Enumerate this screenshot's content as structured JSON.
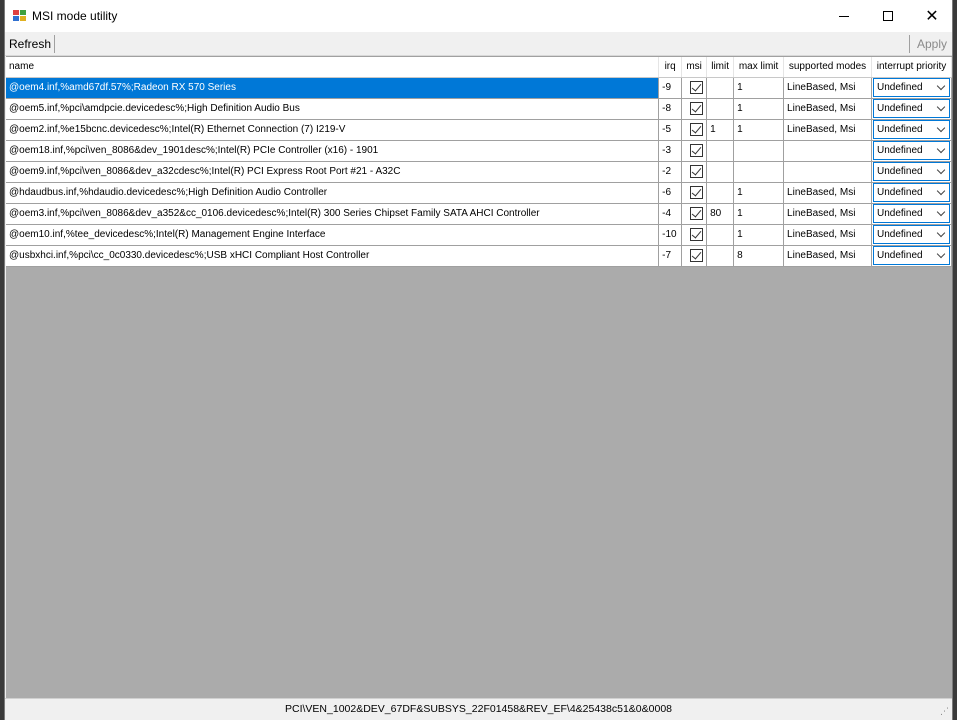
{
  "window": {
    "title": "MSI mode utility"
  },
  "toolbar": {
    "refresh_label": "Refresh",
    "apply_label": "Apply"
  },
  "columns": [
    "name",
    "irq",
    "msi",
    "limit",
    "max limit",
    "supported modes",
    "interrupt priority"
  ],
  "rows": [
    {
      "name": "@oem4.inf,%amd67df.57%;Radeon RX 570 Series",
      "irq": "-9",
      "msi": true,
      "limit": "",
      "max_limit": "1",
      "modes": "LineBased, Msi",
      "priority": "Undefined"
    },
    {
      "name": "@oem5.inf,%pci\\amdpcie.devicedesc%;High Definition Audio Bus",
      "irq": "-8",
      "msi": true,
      "limit": "",
      "max_limit": "1",
      "modes": "LineBased, Msi",
      "priority": "Undefined"
    },
    {
      "name": "@oem2.inf,%e15bcnc.devicedesc%;Intel(R) Ethernet Connection (7) I219-V",
      "irq": "-5",
      "msi": true,
      "limit": "1",
      "max_limit": "1",
      "modes": "LineBased, Msi",
      "priority": "Undefined"
    },
    {
      "name": "@oem18.inf,%pci\\ven_8086&dev_1901desc%;Intel(R) PCIe Controller (x16) - 1901",
      "irq": "-3",
      "msi": true,
      "limit": "",
      "max_limit": "",
      "modes": "",
      "priority": "Undefined"
    },
    {
      "name": "@oem9.inf,%pci\\ven_8086&dev_a32cdesc%;Intel(R) PCI Express Root Port #21 - A32C",
      "irq": "-2",
      "msi": true,
      "limit": "",
      "max_limit": "",
      "modes": "",
      "priority": "Undefined"
    },
    {
      "name": "@hdaudbus.inf,%hdaudio.devicedesc%;High Definition Audio Controller",
      "irq": "-6",
      "msi": true,
      "limit": "",
      "max_limit": "1",
      "modes": "LineBased, Msi",
      "priority": "Undefined"
    },
    {
      "name": "@oem3.inf,%pci\\ven_8086&dev_a352&cc_0106.devicedesc%;Intel(R) 300 Series Chipset Family SATA AHCI Controller",
      "irq": "-4",
      "msi": true,
      "limit": "80",
      "max_limit": "1",
      "modes": "LineBased, Msi",
      "priority": "Undefined"
    },
    {
      "name": "@oem10.inf,%tee_devicedesc%;Intel(R) Management Engine Interface",
      "irq": "-10",
      "msi": true,
      "limit": "",
      "max_limit": "1",
      "modes": "LineBased, Msi",
      "priority": "Undefined"
    },
    {
      "name": "@usbxhci.inf,%pci\\cc_0c0330.devicedesc%;USB xHCI Compliant Host Controller",
      "irq": "-7",
      "msi": true,
      "limit": "",
      "max_limit": "8",
      "modes": "LineBased, Msi",
      "priority": "Undefined"
    }
  ],
  "statusbar": {
    "text": "PCI\\VEN_1002&DEV_67DF&SUBSYS_22F01458&REV_EF\\4&25438c51&0&0008"
  },
  "colors": {
    "selection": "#0078d7",
    "grid_empty": "#ababab",
    "window_bg": "#f0f0f0"
  },
  "icons": {
    "app": "windows-app-icon",
    "minimize": "minimize-icon",
    "maximize": "maximize-icon",
    "close": "close-icon",
    "dropdown": "chevron-down-icon",
    "checkbox": "checkbox-checked-icon",
    "grip": "resize-grip-icon"
  }
}
